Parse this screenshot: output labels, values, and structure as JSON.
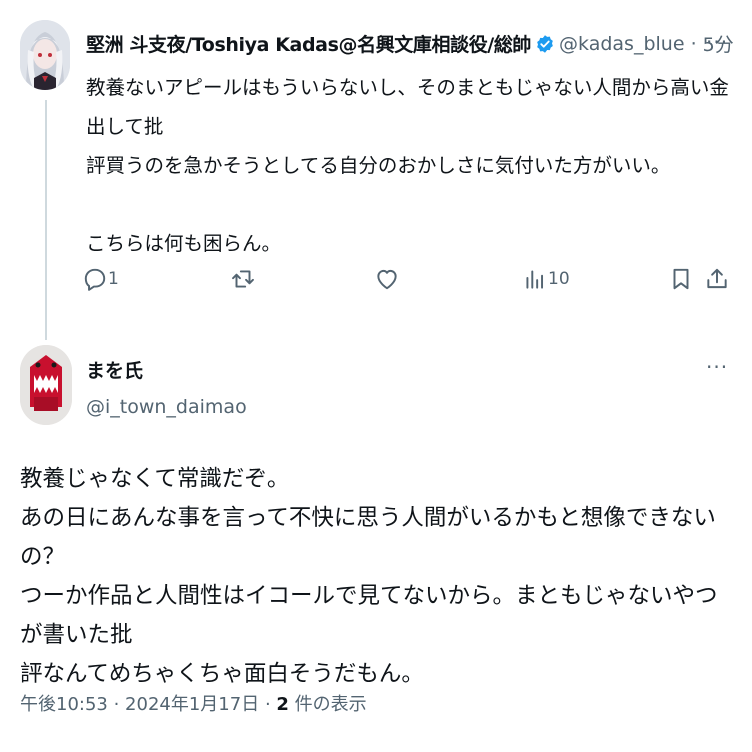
{
  "colors": {
    "text": "#0f1419",
    "secondary": "#536471",
    "verified_blue": "#1d9bf0",
    "thread_line": "#cfd9de",
    "background": "#ffffff"
  },
  "tweet1": {
    "display_name": "堅洲 斗支夜/Toshiya Kadas@名興文庫相談役/総帥",
    "verified_icon": "verified-badge-icon",
    "handle": "@kadas_blue",
    "separator": "·",
    "time": "5分",
    "more_label": "···",
    "body_line1": "教養ないアピールはもういらないし、そのまともじゃない人間から高い金出して批",
    "body_line2": "評買うのを急かそうとしてる自分のおかしさに気付いた方がいい。",
    "body_line3": "こちらは何も困らん。",
    "actions": {
      "reply_count": "1",
      "retweet_count": "",
      "like_count": "",
      "views_count": "10"
    }
  },
  "tweet2": {
    "display_name": "まを氏",
    "handle": "@i_town_daimao",
    "more_label": "···",
    "body_line1": "教養じゃなくて常識だぞ。",
    "body_line2": "あの日にあんな事を言って不快に思う人間がいるかもと想像できないの？",
    "body_line3": "つーか作品と人間性はイコールで見てないから。まともじゃないやつが書いた批",
    "body_line4": "評なんてめちゃくちゃ面白そうだもん。",
    "meta_time": "午後10:53",
    "meta_sep1": " · ",
    "meta_date": "2024年1月17日",
    "meta_sep2": " · ",
    "meta_views_count": "2",
    "meta_views_label": " 件の表示"
  }
}
